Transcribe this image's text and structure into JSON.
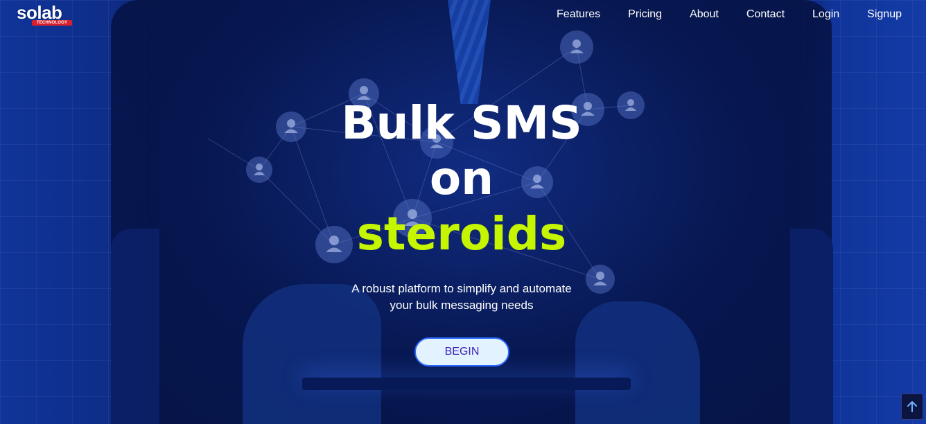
{
  "brand": {
    "logo_text": "solab",
    "logo_subtext": "TECHNOLOGY"
  },
  "nav": {
    "items": [
      {
        "label": "Features"
      },
      {
        "label": "Pricing"
      },
      {
        "label": "About"
      },
      {
        "label": "Contact"
      },
      {
        "label": "Login"
      },
      {
        "label": "Signup"
      }
    ]
  },
  "hero": {
    "headline_line1": "Bulk SMS",
    "headline_line2": "on",
    "headline_accent": "steroids",
    "subtitle_line1": "A robust platform to simplify and automate",
    "subtitle_line2": "your bulk messaging needs",
    "cta_label": "BEGIN"
  },
  "scroll_top": {
    "icon": "arrow-up-icon"
  },
  "colors": {
    "accent": "#c6f500",
    "background": "#0f2f8f",
    "cta_bg": "#e2f3ff",
    "cta_text": "#3d1fb5",
    "cta_border": "#2a67ff",
    "logo_bar": "#d91f2b"
  }
}
